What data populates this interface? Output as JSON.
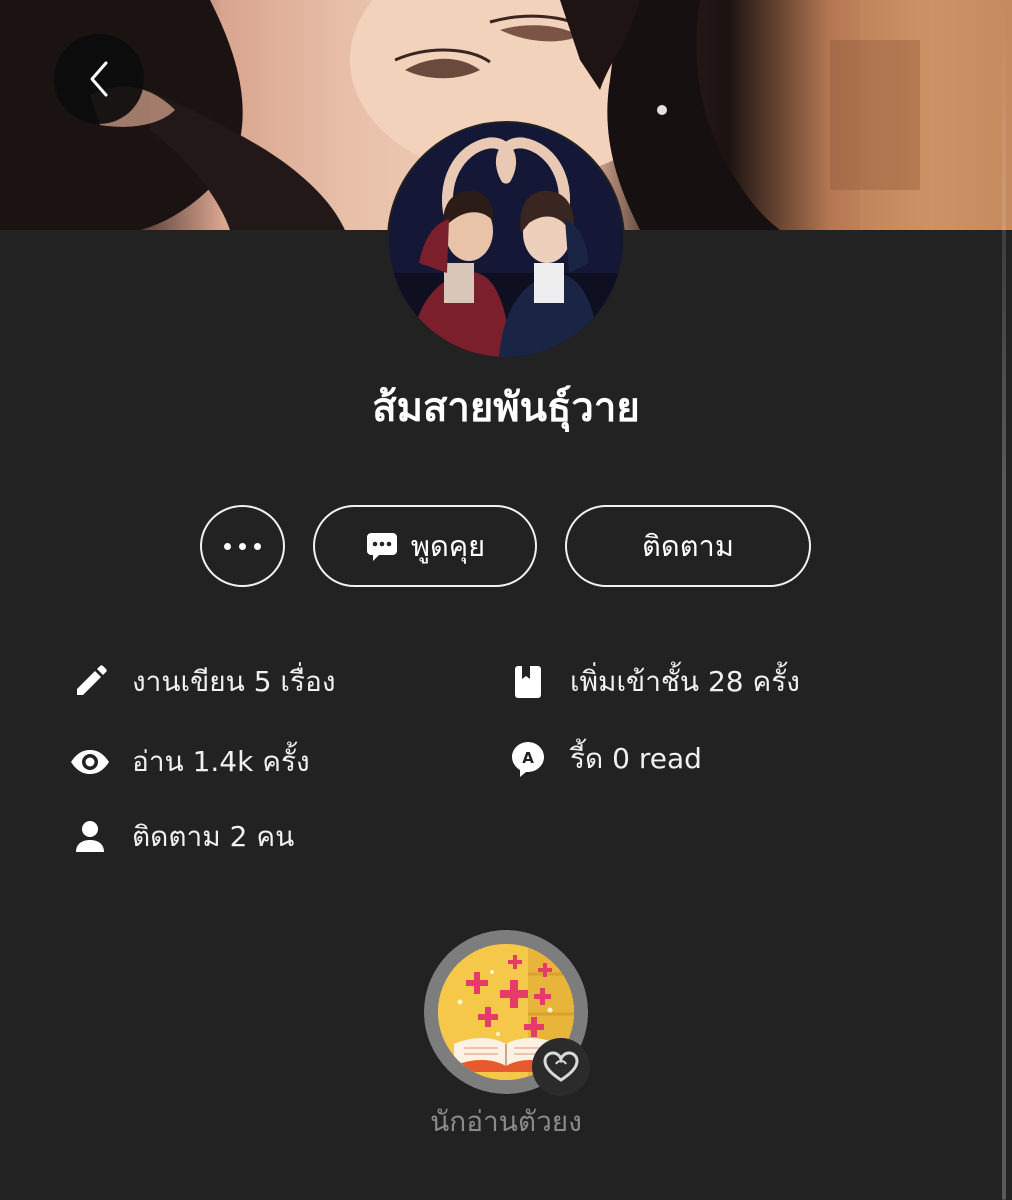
{
  "profile": {
    "display_name": "ส้มสายพันธุ์วาย"
  },
  "actions": {
    "more_icon": "more-horizontal-icon",
    "chat_icon": "chat-bubble-icon",
    "chat_label": "พูดคุย",
    "follow_label": "ติดตาม"
  },
  "stats": {
    "works": {
      "icon": "pencil-icon",
      "label": "งานเขียน 5 เรื่อง"
    },
    "reads": {
      "icon": "eye-icon",
      "label": "อ่าน 1.4k ครั้ง"
    },
    "followers": {
      "icon": "person-icon",
      "label": "ติดตาม 2 คน"
    },
    "shelf_adds": {
      "icon": "bookmark-book-icon",
      "label": "เพิ่มเข้าชั้น 28 ครั้ง"
    },
    "readers": {
      "icon": "read-bubble-icon",
      "label": "รี้ด 0 read"
    }
  },
  "badge": {
    "icon": "open-book-sparkle-icon",
    "corner_icon": "heart-outline-icon",
    "label": "นักอ่านตัวยง"
  },
  "colors": {
    "background": "#222222",
    "text_primary": "#ffffff",
    "text_muted": "#8a8a8a",
    "button_border": "#f2f2f2"
  }
}
